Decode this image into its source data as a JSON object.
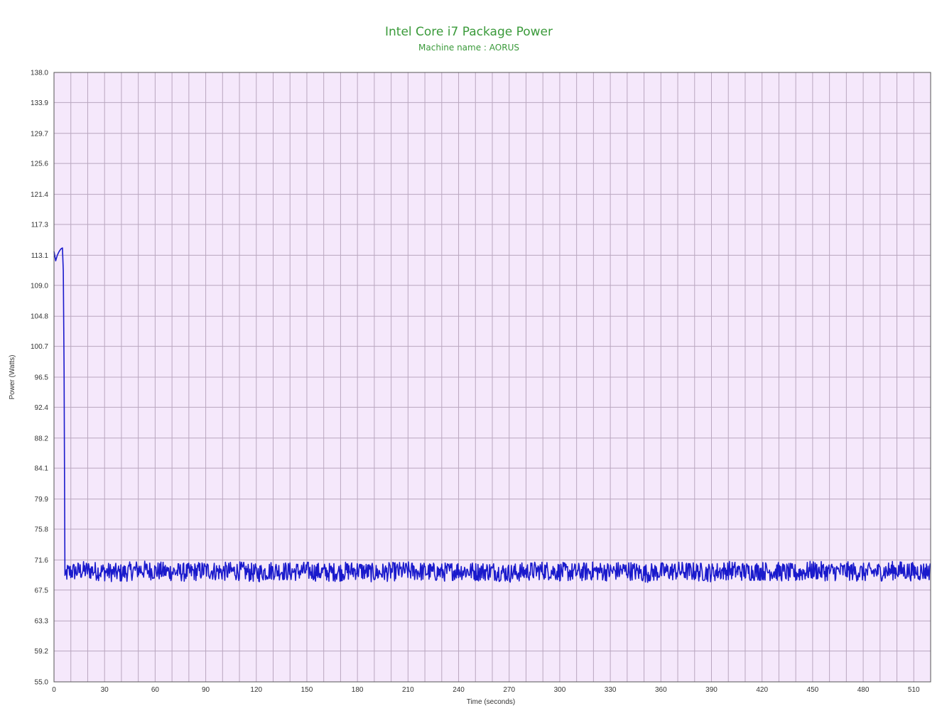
{
  "chart_data": {
    "type": "line",
    "title": "Intel Core i7 Package Power",
    "subtitle": "Machine name : AORUS",
    "xlabel": "Time (seconds)",
    "ylabel": "Power (Watts)",
    "xlim": [
      0,
      520
    ],
    "ylim": [
      55.0,
      138.0
    ],
    "x_ticks": [
      0,
      30,
      60,
      90,
      120,
      150,
      180,
      210,
      240,
      270,
      300,
      330,
      360,
      390,
      420,
      450,
      480,
      510
    ],
    "x_tick_labels": [
      "0",
      "30",
      "60",
      "90",
      "120",
      "150",
      "180",
      "210",
      "240",
      "270",
      "300",
      "330",
      "360",
      "390",
      "420",
      "450",
      "480",
      "510"
    ],
    "y_ticks": [
      55.0,
      59.2,
      63.3,
      67.5,
      71.6,
      75.8,
      79.9,
      84.1,
      88.2,
      92.4,
      96.5,
      100.7,
      104.8,
      109.0,
      113.1,
      117.3,
      121.4,
      125.6,
      129.7,
      133.9,
      138.0
    ],
    "y_tick_labels": [
      "55.0",
      "59.2",
      "63.3",
      "67.5",
      "71.6",
      "75.8",
      "79.9",
      "84.1",
      "88.2",
      "92.4",
      "96.5",
      "100.7",
      "104.8",
      "109.0",
      "113.1",
      "117.3",
      "121.4",
      "125.6",
      "129.7",
      "133.9",
      "138.0"
    ],
    "grid": true,
    "colors": {
      "plot_background": "#f5e8fb",
      "grid": "#b9a6bf",
      "line": "#1a1acc",
      "title": "#3a9a3a"
    },
    "series": [
      {
        "x": [
          0,
          1,
          2,
          3,
          4,
          5,
          5.5,
          6,
          6.5,
          7,
          10,
          20,
          30,
          40,
          50,
          60,
          70,
          80,
          90,
          100,
          110,
          120,
          130,
          140,
          150,
          160,
          170,
          180,
          190,
          200,
          210,
          220,
          230,
          240,
          250,
          260,
          270,
          280,
          290,
          300,
          310,
          320,
          330,
          340,
          350,
          360,
          370,
          380,
          390,
          400,
          410,
          420,
          430,
          440,
          450,
          460,
          470,
          480,
          490,
          500,
          510,
          520
        ],
        "values": [
          113.5,
          112.5,
          113.0,
          113.2,
          113.8,
          114.1,
          111.0,
          97.5,
          69.5,
          69.8,
          70.0,
          70.2,
          70.0,
          69.8,
          70.3,
          70.1,
          70.0,
          69.9,
          70.2,
          70.0,
          70.1,
          69.8,
          70.2,
          70.0,
          70.1,
          69.9,
          70.0,
          70.2,
          69.8,
          70.0,
          70.1,
          70.0,
          69.9,
          70.2,
          70.0,
          70.1,
          69.8,
          70.0,
          70.2,
          70.0,
          69.9,
          70.1,
          70.0,
          70.2,
          69.8,
          70.0,
          70.1,
          70.0,
          69.9,
          70.2,
          70.0,
          70.1,
          70.0,
          69.8,
          70.2,
          70.0,
          70.1,
          69.9,
          70.0,
          70.2,
          70.0,
          70.1
        ],
        "noise_amplitude": 1.3
      }
    ]
  }
}
